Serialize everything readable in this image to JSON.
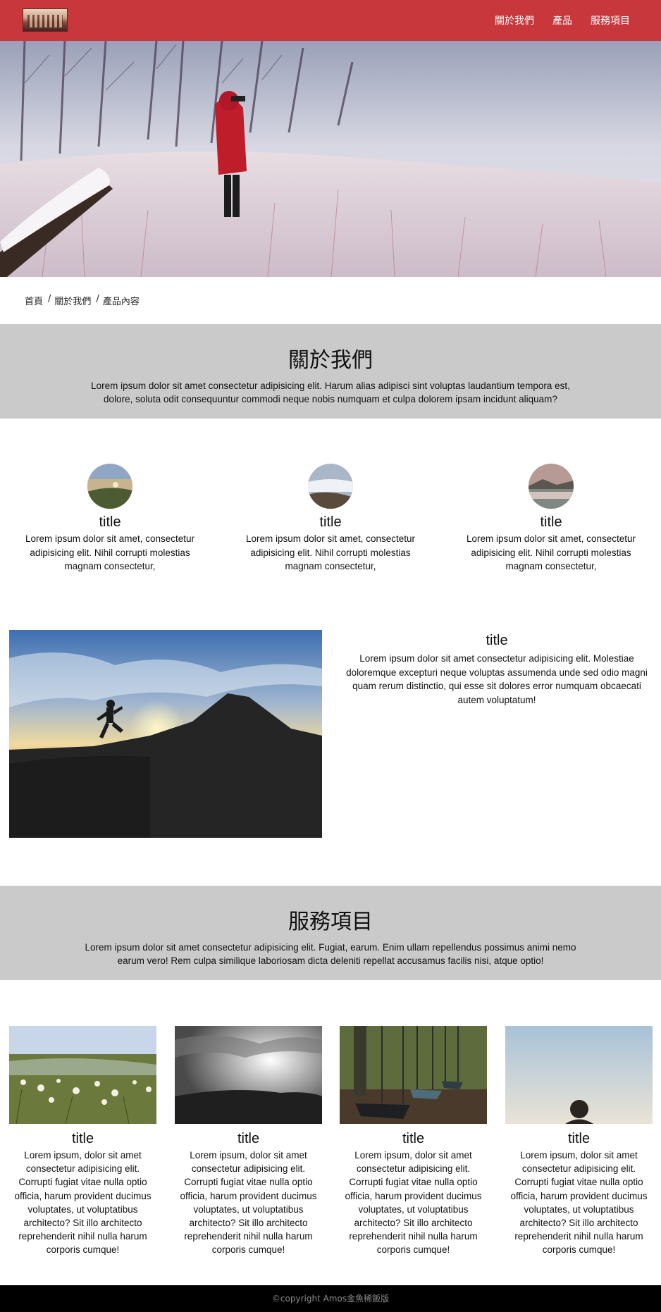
{
  "header": {
    "nav": [
      "關於我們",
      "產品",
      "服務項目"
    ]
  },
  "breadcrumb": [
    "首頁",
    "關於我們",
    "產品內容"
  ],
  "about": {
    "heading": "關於我們",
    "text": "Lorem ipsum dolor sit amet consectetur adipisicing elit. Harum alias adipisci sint voluptas laudantium tempora est, dolore, soluta odit consequuntur commodi neque nobis numquam et culpa dolorem ipsam incidunt aliquam?"
  },
  "features": [
    {
      "title": "title",
      "text": "Lorem ipsum dolor sit amet, consectetur adipisicing elit. Nihil corrupti molestias magnam consectetur,"
    },
    {
      "title": "title",
      "text": "Lorem ipsum dolor sit amet, consectetur adipisicing elit. Nihil corrupti molestias magnam consectetur,"
    },
    {
      "title": "title",
      "text": "Lorem ipsum dolor sit amet, consectetur adipisicing elit. Nihil corrupti molestias magnam consectetur,"
    }
  ],
  "highlight": {
    "title": "title",
    "text": "Lorem ipsum dolor sit amet consectetur adipisicing elit. Molestiae doloremque excepturi neque voluptas assumenda unde sed odio magni quam rerum distinctio, qui esse sit dolores error numquam obcaecati autem voluptatum!"
  },
  "services": {
    "heading": "服務項目",
    "text": "Lorem ipsum dolor sit amet consectetur adipisicing elit. Fugiat, earum. Enim ullam repellendus possimus animi nemo earum vero! Rem culpa similique laboriosam dicta deleniti repellat accusamus facilis nisi, atque optio!"
  },
  "cards": [
    {
      "title": "title",
      "text": "Lorem ipsum, dolor sit amet consectetur adipisicing elit. Corrupti fugiat vitae nulla optio officia, harum provident ducimus voluptates, ut voluptatibus architecto? Sit illo architecto reprehenderit nihil nulla harum corporis cumque!"
    },
    {
      "title": "title",
      "text": "Lorem ipsum, dolor sit amet consectetur adipisicing elit. Corrupti fugiat vitae nulla optio officia, harum provident ducimus voluptates, ut voluptatibus architecto? Sit illo architecto reprehenderit nihil nulla harum corporis cumque!"
    },
    {
      "title": "title",
      "text": "Lorem ipsum, dolor sit amet consectetur adipisicing elit. Corrupti fugiat vitae nulla optio officia, harum provident ducimus voluptates, ut voluptatibus architecto? Sit illo architecto reprehenderit nihil nulla harum corporis cumque!"
    },
    {
      "title": "title",
      "text": "Lorem ipsum, dolor sit amet consectetur adipisicing elit. Corrupti fugiat vitae nulla optio officia, harum provident ducimus voluptates, ut voluptatibus architecto? Sit illo architecto reprehenderit nihil nulla harum corporis cumque!"
    }
  ],
  "footer": {
    "text": "©copyright Amos金魚稀飯版"
  },
  "colors": {
    "header_bg": "#c7373c",
    "band_bg": "#cacaca",
    "footer_bg": "#000000"
  }
}
